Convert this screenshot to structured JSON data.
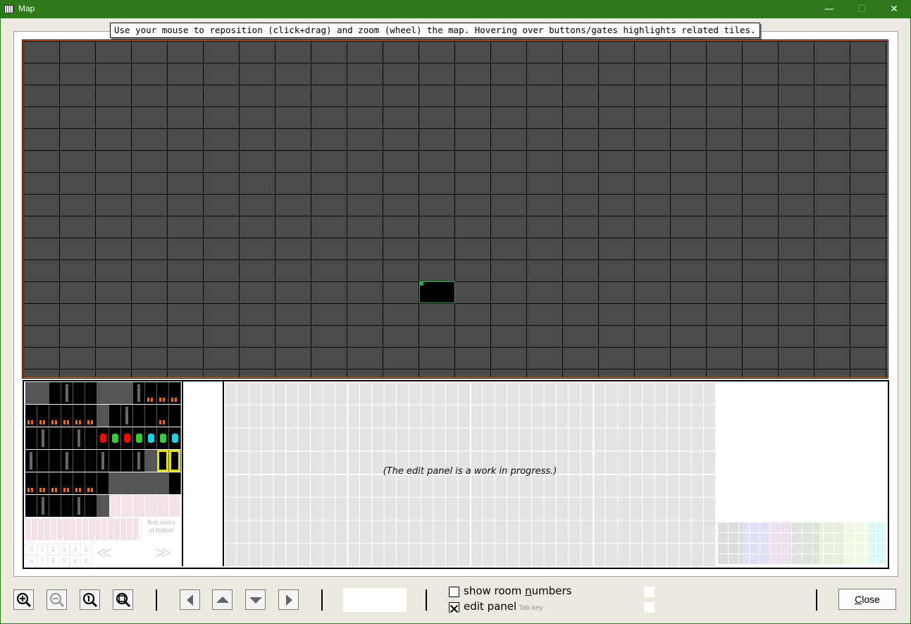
{
  "window": {
    "title": "Map",
    "minimize_glyph": "—",
    "maximize_glyph": "☐",
    "close_glyph": "✕"
  },
  "tooltip": {
    "text": "Use your mouse to reposition (click+drag) and zoom (wheel) the map. Hovering over buttons/gates highlights related tiles."
  },
  "map": {
    "grid_cols": 24,
    "grid_rows": 15,
    "current_room_col": 11,
    "current_room_row": 11,
    "colors": {
      "room_fill": "#4b4b4b",
      "grid_line": "#0a0a0a",
      "border": "#e06a2a",
      "current_room": "#000000",
      "current_room_border": "#2aa84a"
    }
  },
  "edit_panel": {
    "wip_message": "(The edit panel is a work in progress.)",
    "palette_note_line1": "first event",
    "palette_note_line2": "of button",
    "number_cells": [
      "0",
      "1",
      "2",
      "3",
      "4",
      "5",
      "6",
      "7",
      "8",
      "9",
      "a",
      "b"
    ],
    "arrow_left": "≪",
    "arrow_right": "≫"
  },
  "toolbar": {
    "zoom_in_icon": "zoom-in-icon",
    "zoom_out_icon": "zoom-out-icon",
    "zoom_reset_icon": "zoom-reset-icon",
    "zoom_fit_icon": "zoom-fit-icon",
    "room_number_value": "",
    "show_room_numbers": {
      "label_before": "show room ",
      "label_mnemonic": "n",
      "label_after": "umbers",
      "checked": false
    },
    "edit_panel": {
      "label": "edit panel",
      "hint": "Tab key",
      "checked": true
    },
    "close_label_mnemonic": "C",
    "close_label_rest": "lose"
  }
}
